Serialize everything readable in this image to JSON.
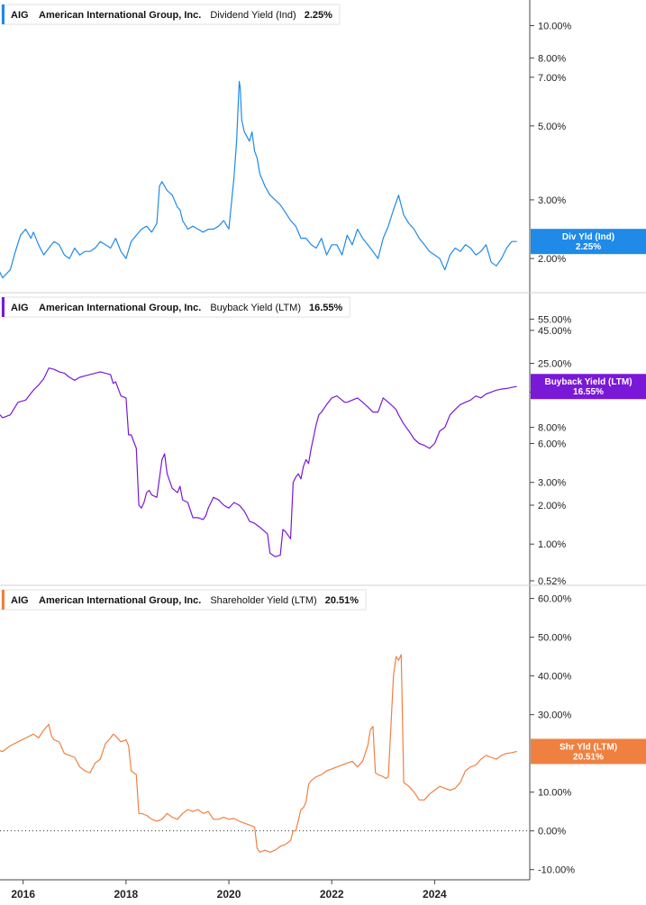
{
  "colors": {
    "dividend": "#1f8ae8",
    "buyback": "#7a18d8",
    "shareholder": "#f08040",
    "grid": "#d0d0d0",
    "axis": "#444444"
  },
  "chart_data": [
    {
      "type": "line",
      "id": "dividend",
      "scale": "log",
      "legend": {
        "ticker": "AIG",
        "company": "American International Group, Inc.",
        "metric": "Dividend Yield (Ind)",
        "value": "2.25%"
      },
      "tag": {
        "label": "Div Yld (Ind)",
        "value": "2.25%"
      },
      "ylim": [
        1.65,
        11.5
      ],
      "yticks": [
        {
          "v": 10,
          "label": "10.00%"
        },
        {
          "v": 8,
          "label": "8.00%"
        },
        {
          "v": 7,
          "label": "7.00%"
        },
        {
          "v": 5,
          "label": "5.00%"
        },
        {
          "v": 3,
          "label": "3.00%"
        },
        {
          "v": 2,
          "label": "2.00%"
        }
      ],
      "x": [
        2015.0,
        2015.15,
        2015.3,
        2015.45,
        2015.6,
        2015.75,
        2015.85,
        2015.95,
        2016.05,
        2016.15,
        2016.2,
        2016.3,
        2016.4,
        2016.5,
        2016.6,
        2016.7,
        2016.8,
        2016.9,
        2017.0,
        2017.1,
        2017.2,
        2017.3,
        2017.4,
        2017.5,
        2017.6,
        2017.7,
        2017.8,
        2017.9,
        2018.0,
        2018.1,
        2018.2,
        2018.3,
        2018.4,
        2018.5,
        2018.6,
        2018.65,
        2018.7,
        2018.8,
        2018.9,
        2019.0,
        2019.05,
        2019.1,
        2019.2,
        2019.3,
        2019.4,
        2019.5,
        2019.6,
        2019.7,
        2019.8,
        2019.9,
        2020.0,
        2020.1,
        2020.15,
        2020.2,
        2020.22,
        2020.25,
        2020.3,
        2020.4,
        2020.45,
        2020.5,
        2020.55,
        2020.6,
        2020.7,
        2020.8,
        2020.9,
        2021.0,
        2021.1,
        2021.2,
        2021.3,
        2021.4,
        2021.5,
        2021.6,
        2021.7,
        2021.8,
        2021.9,
        2022.0,
        2022.1,
        2022.2,
        2022.3,
        2022.4,
        2022.5,
        2022.6,
        2022.7,
        2022.8,
        2022.9,
        2023.0,
        2023.1,
        2023.2,
        2023.3,
        2023.4,
        2023.5,
        2023.6,
        2023.7,
        2023.8,
        2023.9,
        2024.0,
        2024.1,
        2024.2,
        2024.3,
        2024.4,
        2024.5,
        2024.6,
        2024.7,
        2024.8,
        2024.9,
        2025.0,
        2025.1,
        2025.2,
        2025.3,
        2025.4,
        2025.5,
        2025.6
      ],
      "y": [
        1.8,
        2.0,
        1.9,
        1.95,
        1.75,
        1.85,
        2.1,
        2.35,
        2.45,
        2.3,
        2.4,
        2.2,
        2.05,
        2.15,
        2.25,
        2.2,
        2.05,
        2.0,
        2.15,
        2.05,
        2.1,
        2.1,
        2.15,
        2.25,
        2.2,
        2.15,
        2.3,
        2.1,
        2.0,
        2.25,
        2.35,
        2.45,
        2.5,
        2.4,
        2.55,
        3.3,
        3.4,
        3.2,
        3.1,
        2.85,
        2.8,
        2.6,
        2.45,
        2.5,
        2.45,
        2.4,
        2.45,
        2.45,
        2.5,
        2.6,
        2.45,
        3.5,
        4.5,
        6.8,
        6.5,
        5.2,
        4.8,
        4.5,
        4.8,
        4.2,
        4.0,
        3.6,
        3.3,
        3.1,
        3.0,
        2.9,
        2.75,
        2.6,
        2.5,
        2.3,
        2.3,
        2.2,
        2.15,
        2.3,
        2.05,
        2.2,
        2.2,
        2.05,
        2.35,
        2.2,
        2.45,
        2.3,
        2.2,
        2.1,
        2.0,
        2.3,
        2.5,
        2.8,
        3.1,
        2.7,
        2.55,
        2.45,
        2.3,
        2.2,
        2.1,
        2.05,
        2.0,
        1.85,
        2.05,
        2.15,
        2.1,
        2.2,
        2.15,
        2.05,
        2.1,
        2.2,
        1.95,
        1.9,
        2.0,
        2.15,
        2.25,
        2.25
      ]
    },
    {
      "type": "line",
      "id": "buyback",
      "scale": "log",
      "legend": {
        "ticker": "AIG",
        "company": "American International Group, Inc.",
        "metric": "Buyback Yield (LTM)",
        "value": "16.55%"
      },
      "tag": {
        "label": "Buyback Yield (LTM)",
        "value": "16.55%"
      },
      "ylim": [
        0.52,
        80
      ],
      "yticks": [
        {
          "v": 55,
          "label": "55.00%"
        },
        {
          "v": 45,
          "label": "45.00%"
        },
        {
          "v": 25,
          "label": "25.00%"
        },
        {
          "v": 15,
          "label": "15.00%"
        },
        {
          "v": 8,
          "label": "8.00%"
        },
        {
          "v": 6,
          "label": "6.00%"
        },
        {
          "v": 3,
          "label": "3.00%"
        },
        {
          "v": 2,
          "label": "2.00%"
        },
        {
          "v": 1,
          "label": "1.00%"
        },
        {
          "v": 0.52,
          "label": "0.52%"
        }
      ],
      "x": [
        2015.0,
        2015.1,
        2015.2,
        2015.3,
        2015.45,
        2015.6,
        2015.75,
        2015.9,
        2016.05,
        2016.2,
        2016.3,
        2016.4,
        2016.5,
        2016.6,
        2016.7,
        2016.8,
        2016.9,
        2017.0,
        2017.1,
        2017.2,
        2017.3,
        2017.4,
        2017.5,
        2017.6,
        2017.7,
        2017.75,
        2017.8,
        2017.9,
        2018.0,
        2018.05,
        2018.1,
        2018.2,
        2018.25,
        2018.3,
        2018.35,
        2018.4,
        2018.45,
        2018.5,
        2018.6,
        2018.7,
        2018.75,
        2018.8,
        2018.9,
        2019.0,
        2019.05,
        2019.1,
        2019.2,
        2019.3,
        2019.4,
        2019.5,
        2019.55,
        2019.6,
        2019.7,
        2019.8,
        2019.9,
        2020.0,
        2020.1,
        2020.2,
        2020.25,
        2020.3,
        2020.35,
        2020.4,
        2020.5,
        2020.6,
        2020.7,
        2020.75,
        2020.8,
        2020.9,
        2021.0,
        2021.05,
        2021.1,
        2021.2,
        2021.25,
        2021.3,
        2021.35,
        2021.4,
        2021.45,
        2021.5,
        2021.55,
        2021.6,
        2021.7,
        2021.75,
        2021.8,
        2021.9,
        2022.0,
        2022.1,
        2022.2,
        2022.25,
        2022.3,
        2022.4,
        2022.5,
        2022.6,
        2022.7,
        2022.8,
        2022.9,
        2023.0,
        2023.1,
        2023.2,
        2023.25,
        2023.3,
        2023.4,
        2023.5,
        2023.6,
        2023.7,
        2023.8,
        2023.9,
        2024.0,
        2024.1,
        2024.2,
        2024.3,
        2024.4,
        2024.5,
        2024.6,
        2024.7,
        2024.8,
        2024.9,
        2025.0,
        2025.1,
        2025.2,
        2025.3,
        2025.4,
        2025.5,
        2025.6
      ],
      "y": [
        9.0,
        10.5,
        11.0,
        10.5,
        11.0,
        9.5,
        10.0,
        12.5,
        13.0,
        15.5,
        17.0,
        19.0,
        23.0,
        22.5,
        21.5,
        21.0,
        19.5,
        18.5,
        19.5,
        20.0,
        20.5,
        21.0,
        21.5,
        21.0,
        20.5,
        17.5,
        18.0,
        14.0,
        13.5,
        7.0,
        7.0,
        5.5,
        2.0,
        1.9,
        2.1,
        2.5,
        2.6,
        2.4,
        2.3,
        4.5,
        5.0,
        3.5,
        2.7,
        2.5,
        2.8,
        2.2,
        2.1,
        1.6,
        1.6,
        1.55,
        1.65,
        1.9,
        2.3,
        2.2,
        2.0,
        1.9,
        2.1,
        2.0,
        1.9,
        1.8,
        1.65,
        1.5,
        1.45,
        1.35,
        1.25,
        1.2,
        0.85,
        0.8,
        0.82,
        1.3,
        1.25,
        1.1,
        3.0,
        3.3,
        3.5,
        3.2,
        4.0,
        4.5,
        4.2,
        5.5,
        8.5,
        10.0,
        10.5,
        12.0,
        13.5,
        14.0,
        13.0,
        12.5,
        12.5,
        13.0,
        13.5,
        12.5,
        11.5,
        10.5,
        10.5,
        13.5,
        12.5,
        11.5,
        11.0,
        10.0,
        8.5,
        7.5,
        6.5,
        6.0,
        5.8,
        5.5,
        6.0,
        7.5,
        8.0,
        10.0,
        11.0,
        12.0,
        12.5,
        13.0,
        14.0,
        13.5,
        14.5,
        15.0,
        15.5,
        15.8,
        16.0,
        16.3,
        16.55
      ]
    },
    {
      "type": "line",
      "id": "shareholder",
      "scale": "linear",
      "legend": {
        "ticker": "AIG",
        "company": "American International Group, Inc.",
        "metric": "Shareholder Yield (LTM)",
        "value": "20.51%"
      },
      "tag": {
        "label": "Shr Yld (LTM)",
        "value": "20.51%"
      },
      "ylim": [
        -11.0,
        62.0
      ],
      "zero_line": true,
      "yticks": [
        {
          "v": 60,
          "label": "60.00%"
        },
        {
          "v": 50,
          "label": "50.00%"
        },
        {
          "v": 40,
          "label": "40.00%"
        },
        {
          "v": 30,
          "label": "30.00%"
        },
        {
          "v": 10,
          "label": "10.00%"
        },
        {
          "v": 0,
          "label": "0.00%"
        },
        {
          "v": -10,
          "label": "-10.00%"
        }
      ],
      "x": [
        2015.0,
        2015.1,
        2015.2,
        2015.3,
        2015.45,
        2015.6,
        2015.75,
        2015.9,
        2016.05,
        2016.2,
        2016.3,
        2016.4,
        2016.5,
        2016.55,
        2016.6,
        2016.7,
        2016.8,
        2016.9,
        2017.0,
        2017.1,
        2017.2,
        2017.3,
        2017.4,
        2017.5,
        2017.6,
        2017.7,
        2017.75,
        2017.8,
        2017.9,
        2018.0,
        2018.05,
        2018.1,
        2018.2,
        2018.25,
        2018.3,
        2018.4,
        2018.5,
        2018.6,
        2018.7,
        2018.8,
        2018.9,
        2019.0,
        2019.1,
        2019.2,
        2019.3,
        2019.4,
        2019.5,
        2019.6,
        2019.7,
        2019.8,
        2019.9,
        2020.0,
        2020.1,
        2020.2,
        2020.3,
        2020.4,
        2020.5,
        2020.55,
        2020.6,
        2020.7,
        2020.8,
        2020.9,
        2021.0,
        2021.1,
        2021.2,
        2021.25,
        2021.3,
        2021.4,
        2021.45,
        2021.5,
        2021.55,
        2021.6,
        2021.7,
        2021.8,
        2021.9,
        2022.0,
        2022.1,
        2022.2,
        2022.3,
        2022.4,
        2022.5,
        2022.6,
        2022.7,
        2022.75,
        2022.8,
        2022.85,
        2022.9,
        2023.0,
        2023.05,
        2023.1,
        2023.15,
        2023.2,
        2023.25,
        2023.3,
        2023.35,
        2023.4,
        2023.5,
        2023.6,
        2023.7,
        2023.8,
        2023.9,
        2024.0,
        2024.1,
        2024.2,
        2024.3,
        2024.4,
        2024.5,
        2024.6,
        2024.7,
        2024.8,
        2024.9,
        2025.0,
        2025.1,
        2025.2,
        2025.3,
        2025.4,
        2025.5,
        2025.6
      ],
      "y": [
        19.0,
        20.0,
        21.5,
        20.5,
        21.0,
        20.5,
        22.0,
        23.0,
        24.0,
        25.0,
        24.0,
        26.0,
        27.5,
        24.5,
        23.5,
        23.0,
        20.0,
        19.5,
        19.0,
        16.5,
        15.5,
        15.0,
        17.5,
        18.5,
        22.5,
        24.0,
        25.0,
        24.5,
        23.0,
        23.5,
        22.0,
        15.5,
        14.5,
        4.5,
        4.5,
        4.0,
        3.0,
        2.5,
        3.0,
        4.5,
        3.5,
        3.0,
        4.5,
        5.5,
        5.0,
        5.5,
        4.5,
        5.0,
        3.0,
        3.0,
        3.5,
        3.0,
        3.2,
        2.5,
        2.0,
        1.5,
        1.0,
        -4.5,
        -5.5,
        -5.0,
        -5.5,
        -5.0,
        -4.0,
        -3.5,
        -2.5,
        0.0,
        0.0,
        5.5,
        6.0,
        7.5,
        12.0,
        13.0,
        14.0,
        14.5,
        15.5,
        16.0,
        16.5,
        17.0,
        17.5,
        18.0,
        16.5,
        18.0,
        22.0,
        26.0,
        27.0,
        15.0,
        14.5,
        14.0,
        13.5,
        14.0,
        27.0,
        40.0,
        45.0,
        44.0,
        45.5,
        12.5,
        11.5,
        10.0,
        8.0,
        8.0,
        9.5,
        10.5,
        11.5,
        11.0,
        10.5,
        11.0,
        12.5,
        15.5,
        16.5,
        17.0,
        18.5,
        19.5,
        19.0,
        18.5,
        19.5,
        20.0,
        20.2,
        20.51
      ]
    }
  ],
  "xaxis": {
    "xlim": [
      2015.55,
      2025.85
    ],
    "ticks": [
      {
        "v": 2016,
        "label": "2016"
      },
      {
        "v": 2018,
        "label": "2018"
      },
      {
        "v": 2020,
        "label": "2020"
      },
      {
        "v": 2022,
        "label": "2022"
      },
      {
        "v": 2024,
        "label": "2024"
      }
    ]
  }
}
